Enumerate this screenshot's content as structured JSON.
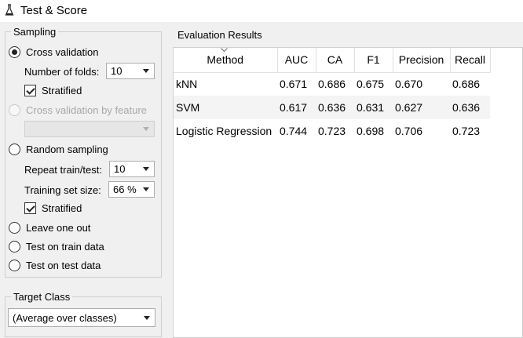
{
  "window": {
    "title": "Test & Score",
    "icon": "flask-icon"
  },
  "sampling": {
    "group_title": "Sampling",
    "cross_validation": {
      "label": "Cross validation",
      "checked": true
    },
    "folds": {
      "label": "Number of folds:",
      "value": "10"
    },
    "stratified_cv": {
      "label": "Stratified",
      "checked": true
    },
    "cv_by_feature": {
      "label": "Cross validation by feature",
      "enabled": false,
      "value": ""
    },
    "random_sampling": {
      "label": "Random sampling",
      "checked": false
    },
    "repeat": {
      "label": "Repeat train/test:",
      "value": "10"
    },
    "training_size": {
      "label": "Training set size:",
      "value": "66 %"
    },
    "stratified_rs": {
      "label": "Stratified",
      "checked": true
    },
    "leave_one_out": {
      "label": "Leave one out",
      "checked": false
    },
    "test_on_train": {
      "label": "Test on train data",
      "checked": false
    },
    "test_on_test": {
      "label": "Test on test data",
      "checked": false
    }
  },
  "target_class": {
    "group_title": "Target Class",
    "value": "(Average over classes)"
  },
  "evaluation": {
    "title": "Evaluation Results",
    "columns": [
      "Method",
      "AUC",
      "CA",
      "F1",
      "Precision",
      "Recall"
    ],
    "rows": [
      [
        "kNN",
        "0.671",
        "0.686",
        "0.675",
        "0.670",
        "0.686"
      ],
      [
        "SVM",
        "0.617",
        "0.636",
        "0.631",
        "0.627",
        "0.636"
      ],
      [
        "Logistic Regression",
        "0.744",
        "0.723",
        "0.698",
        "0.706",
        "0.723"
      ]
    ]
  }
}
